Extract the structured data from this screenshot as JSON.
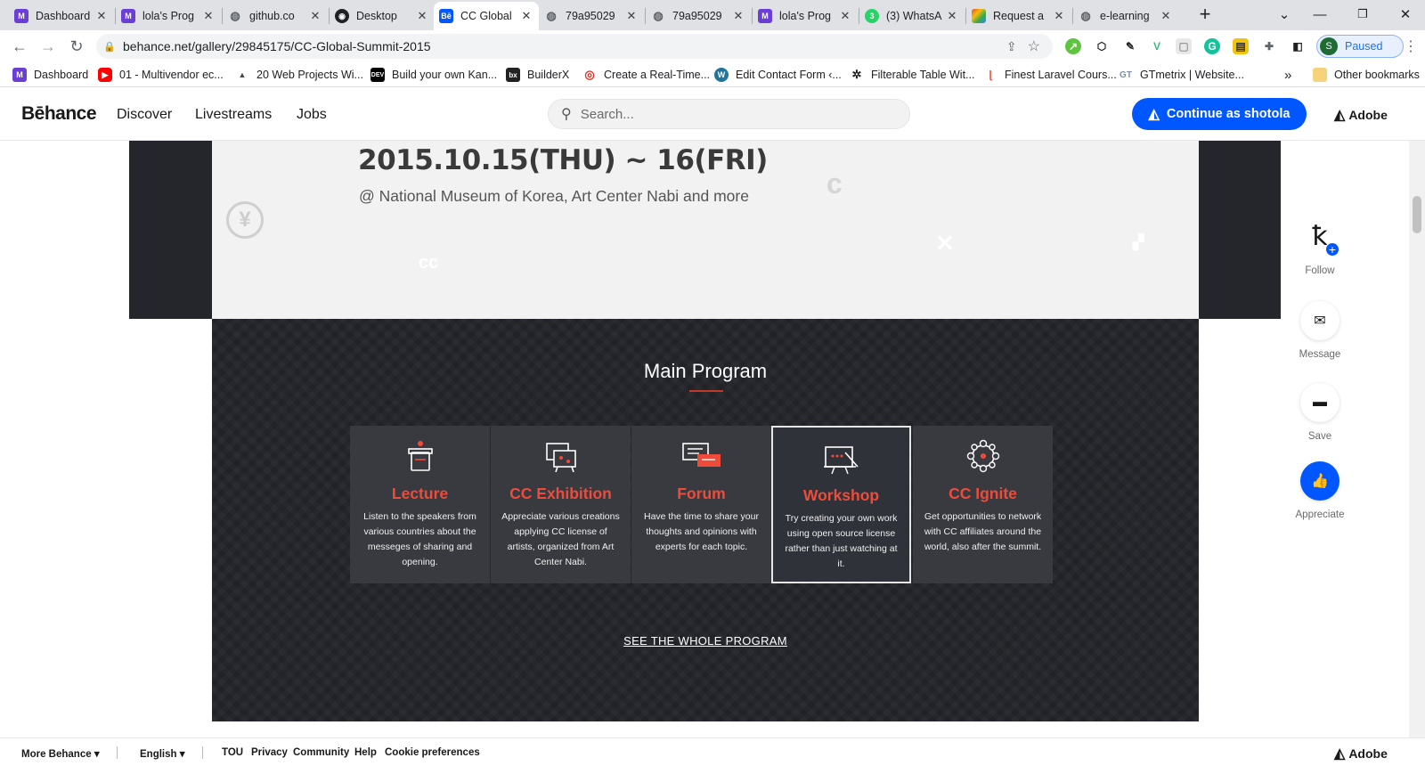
{
  "browser": {
    "tabs": [
      {
        "title": "Dashboard",
        "icon": "m-icon",
        "color": "#6b3fd6"
      },
      {
        "title": "lola's Prog",
        "icon": "m-icon",
        "color": "#6b3fd6"
      },
      {
        "title": "github.co",
        "icon": "globe-icon",
        "color": "#5f6368"
      },
      {
        "title": "Desktop",
        "icon": "github-icon",
        "color": "#202124"
      },
      {
        "title": "CC Global",
        "icon": "behance-icon",
        "color": "#0057ff"
      },
      {
        "title": "79a95029",
        "icon": "globe-icon",
        "color": "#5f6368"
      },
      {
        "title": "79a95029",
        "icon": "globe-icon",
        "color": "#5f6368"
      },
      {
        "title": "lola's Prog",
        "icon": "m-icon",
        "color": "#6b3fd6"
      },
      {
        "title": "(3) WhatsA",
        "icon": "whatsapp-icon",
        "color": "#25d366"
      },
      {
        "title": "Request a",
        "icon": "request-icon",
        "color": "#f4b400"
      },
      {
        "title": "e-learning",
        "icon": "globe-icon",
        "color": "#5f6368"
      }
    ],
    "new_tab": "+",
    "url": "behance.net/gallery/29845175/CC-Global-Summit-2015",
    "profile_initial": "S",
    "profile_status": "Paused",
    "bookmarks": [
      {
        "label": "Dashboard",
        "icon": "m-icon"
      },
      {
        "label": "01 - Multivendor ec...",
        "icon": "youtube-icon"
      },
      {
        "label": "20 Web Projects Wi...",
        "icon": "bookmark-icon"
      },
      {
        "label": "Build your own Kan...",
        "icon": "dev-icon"
      },
      {
        "label": "BuilderX",
        "icon": "builderx-icon"
      },
      {
        "label": "Create a Real-Time...",
        "icon": "target-icon"
      },
      {
        "label": "Edit Contact Form ‹...",
        "icon": "wordpress-icon"
      },
      {
        "label": "Filterable Table Wit...",
        "icon": "settings-icon"
      },
      {
        "label": "Finest Laravel Cours...",
        "icon": "laravel-icon"
      },
      {
        "label": "GTmetrix | Website...",
        "icon": "gtmetrix-icon"
      }
    ],
    "bookmarks_more": "»",
    "other_bookmarks": "Other bookmarks"
  },
  "behance": {
    "logo": "Bēhance",
    "nav": [
      "Discover",
      "Livestreams",
      "Jobs"
    ],
    "search_placeholder": "Search...",
    "continue_button": "Continue as shotola",
    "adobe": "Adobe"
  },
  "banner": {
    "date": "2015.10.15(THU) ~ 16(FRI)",
    "venue": "@ National Museum of Korea, Art Center Nabi and more"
  },
  "program": {
    "title": "Main Program",
    "accent": "#ef4b3a",
    "cards": [
      {
        "name": "Lecture",
        "desc": "Listen to the speakers from various countries about the messeges of sharing and opening.",
        "icon": "lecture-icon"
      },
      {
        "name": "CC Exhibition",
        "desc": "Appreciate various creations applying CC license of artists, organized from Art Center Nabi.",
        "icon": "exhibition-icon"
      },
      {
        "name": "Forum",
        "desc": "Have the time to share your thoughts and opinions with experts for each topic.",
        "icon": "forum-icon"
      },
      {
        "name": "Workshop",
        "desc": "Try creating your own work using open source license rather than just watching at it.",
        "icon": "workshop-icon"
      },
      {
        "name": "CC Ignite",
        "desc": "Get opportunities to network with CC affiliates around the world, also after the summit.",
        "icon": "network-icon"
      }
    ],
    "see_all": "SEE THE WHOLE PROGRAM"
  },
  "rail": {
    "follow": "Follow",
    "message": "Message",
    "save": "Save",
    "appreciate": "Appreciate",
    "appreciate_color": "#0057ff"
  },
  "footer": {
    "more": "More Behance",
    "language": "English",
    "links": [
      "TOU",
      "Privacy",
      "Community",
      "Help",
      "Cookie preferences"
    ],
    "adobe": "Adobe"
  }
}
